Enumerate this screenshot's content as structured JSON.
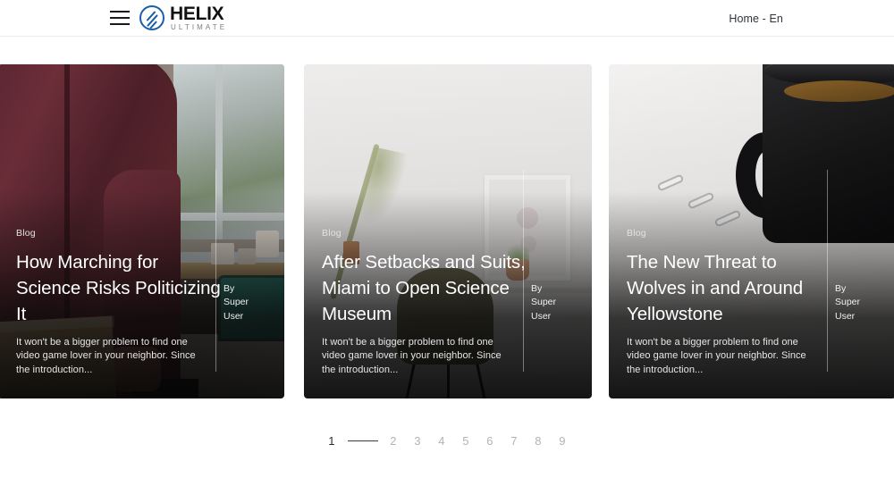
{
  "header": {
    "menu_icon": "hamburger-icon",
    "logo": {
      "mark_icon": "helix-circle-icon",
      "title": "HELIX",
      "subtitle": "ULTIMATE"
    },
    "nav_right": "Home - En"
  },
  "cards": [
    {
      "category": "Blog",
      "title": "How Marching for Science Risks Politicizing It",
      "excerpt": "It won't be a bigger problem to find one video game lover in your neighbor. Since the introduction...",
      "author_prefix": "By",
      "author_first": "Super",
      "author_last": "User",
      "image_alt": "person-in-maroon-shirt-holding-cardboard-box"
    },
    {
      "category": "Blog",
      "title": "After Setbacks and Suits, Miami to Open Science Museum",
      "excerpt": "It won't be a bigger problem to find one video game lover in your neighbor. Since the introduction...",
      "author_prefix": "By",
      "author_first": "Super",
      "author_last": "User",
      "image_alt": "bright-room-with-chair-frame-and-plant"
    },
    {
      "category": "Blog",
      "title": "The New Threat to Wolves in and Around Yellowstone",
      "excerpt": "It won't be a bigger problem to find one video game lover in your neighbor. Since the introduction...",
      "author_prefix": "By",
      "author_first": "Super",
      "author_last": "User",
      "image_alt": "black-coffee-mug-with-paperclips"
    }
  ],
  "pagination": {
    "current": "1",
    "pages": [
      "1",
      "2",
      "3",
      "4",
      "5",
      "6",
      "7",
      "8",
      "9"
    ]
  },
  "colors": {
    "brand_blue": "#1b5fa8",
    "text_dark": "#111111",
    "pagination_inactive": "#b3b3b3",
    "pagination_active": "#2b2b2b",
    "header_border": "#ececec"
  }
}
